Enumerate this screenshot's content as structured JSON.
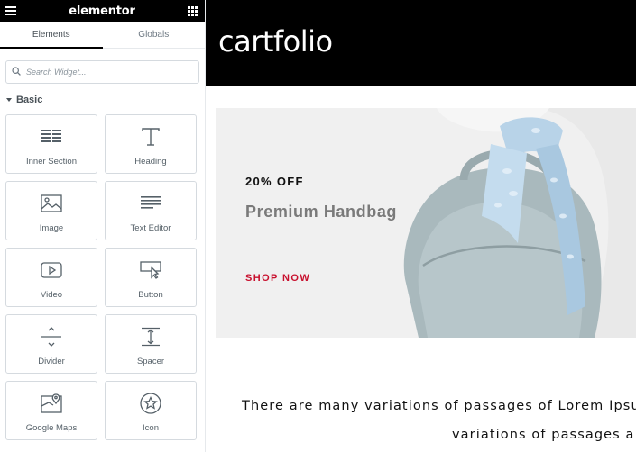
{
  "panel": {
    "brand": "elementor",
    "tabs": [
      {
        "label": "Elements"
      },
      {
        "label": "Globals"
      }
    ],
    "search": {
      "placeholder": "Search Widget..."
    },
    "category": "Basic",
    "widgets": [
      {
        "label": "Inner Section",
        "icon": "inner-section-icon"
      },
      {
        "label": "Heading",
        "icon": "heading-icon"
      },
      {
        "label": "Image",
        "icon": "image-icon"
      },
      {
        "label": "Text Editor",
        "icon": "text-editor-icon"
      },
      {
        "label": "Video",
        "icon": "video-icon"
      },
      {
        "label": "Button",
        "icon": "button-icon"
      },
      {
        "label": "Divider",
        "icon": "divider-icon"
      },
      {
        "label": "Spacer",
        "icon": "spacer-icon"
      },
      {
        "label": "Google Maps",
        "icon": "google-maps-icon"
      },
      {
        "label": "Icon",
        "icon": "star-icon"
      }
    ]
  },
  "site": {
    "logo": "cartfolio",
    "banner": {
      "offer": "20% OFF",
      "product": "Premium Handbag",
      "cta": "SHOP NOW"
    },
    "body_line1": "There are many variations of passages of Lorem Ipsum",
    "body_line2": "variations of passages a"
  },
  "colors": {
    "header_bg": "#000000",
    "cta": "#c8102e",
    "banner_bg": "#f0f0f0"
  }
}
